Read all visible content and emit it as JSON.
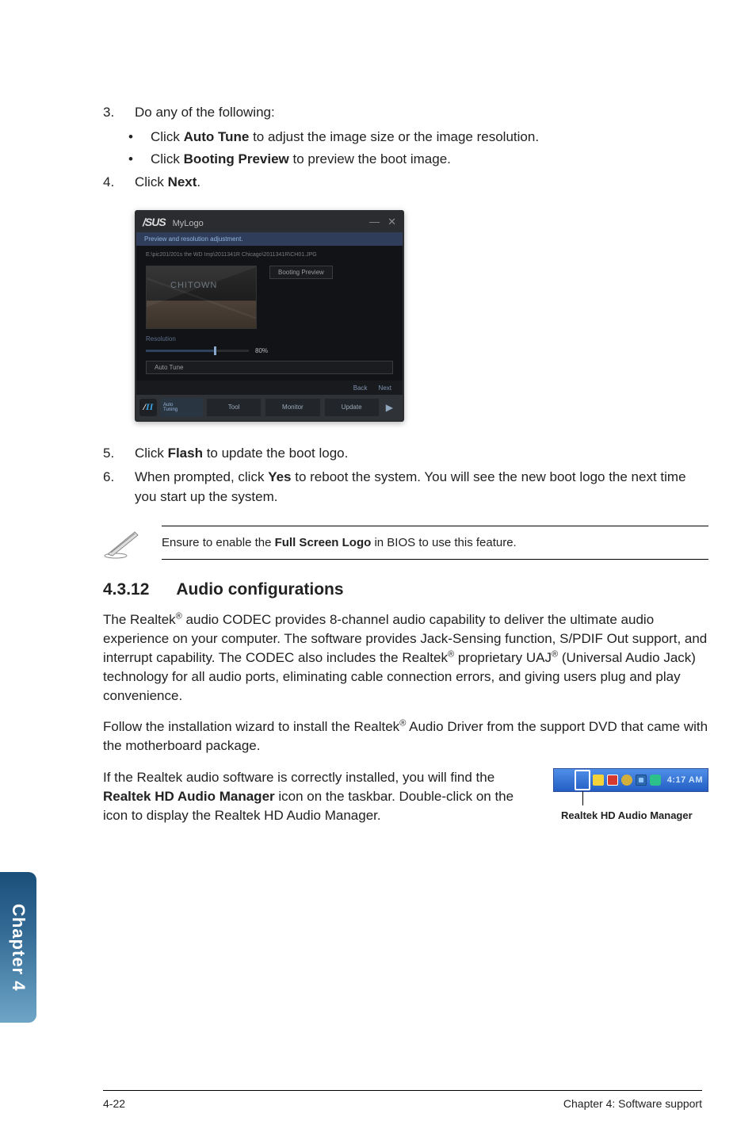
{
  "steps": {
    "s3": {
      "num": "3.",
      "text": "Do any of the following:"
    },
    "s3a": {
      "prefix": "Click ",
      "bold": "Auto Tune",
      "suffix": " to adjust the image size or the image resolution."
    },
    "s3b": {
      "prefix": "Click ",
      "bold": "Booting Preview",
      "suffix": " to preview the boot image."
    },
    "s4": {
      "num": "4.",
      "prefix": "Click ",
      "bold": "Next",
      "suffix": "."
    },
    "s5": {
      "num": "5.",
      "prefix": "Click ",
      "bold": "Flash",
      "suffix": " to update the boot logo."
    },
    "s6": {
      "num": "6.",
      "prefix": "When prompted, click ",
      "bold": "Yes",
      "suffix": " to reboot the system. You will see the new boot logo the next time you start up the system."
    }
  },
  "shot": {
    "brand": "/SUS",
    "window": "MyLogo",
    "subtitle": "Preview and resolution adjustment.",
    "path": "E:\\pic201/201s the WD Imp\\2011341R Chicago\\2011341R\\CH01.JPG",
    "thumb_label": "CHITOWN",
    "preview_btn": "Booting Preview",
    "res_label": "Resolution",
    "pct": "80%",
    "auto_tune": "Auto Tune",
    "back": "Back",
    "next": "Next",
    "tile_small1": "Auto",
    "tile_small2": "Tuning",
    "tiles": [
      "Tool",
      "Monitor",
      "Update"
    ]
  },
  "note": {
    "pre": "Ensure to enable the ",
    "bold": "Full Screen Logo",
    "post": " in BIOS to use this feature."
  },
  "section": {
    "num": "4.3.12",
    "title": "Audio configurations"
  },
  "para1": {
    "a": "The Realtek",
    "b": " audio CODEC provides 8-channel audio capability to deliver the ultimate audio experience on your computer. The software provides Jack-Sensing function, S/PDIF Out support, and interrupt capability. The CODEC also includes the Realtek",
    "c": " proprietary UAJ",
    "d": " (Universal Audio Jack) technology for all audio ports, eliminating cable connection errors, and giving users plug and play convenience."
  },
  "para2": {
    "a": "Follow the installation wizard to install the Realtek",
    "b": " Audio Driver from the support DVD that came with the motherboard package."
  },
  "para3": {
    "a": "If the Realtek audio software is correctly installed, you will find the ",
    "bold": "Realtek HD Audio Manager",
    "b": " icon on the taskbar. Double-click on the icon to display the Realtek HD Audio Manager."
  },
  "taskbar": {
    "time": "4:17 AM",
    "caption": "Realtek HD Audio Manager"
  },
  "sidetab": "Chapter 4",
  "footer": {
    "left": "4-22",
    "right": "Chapter 4: Software support"
  },
  "reg": "®"
}
